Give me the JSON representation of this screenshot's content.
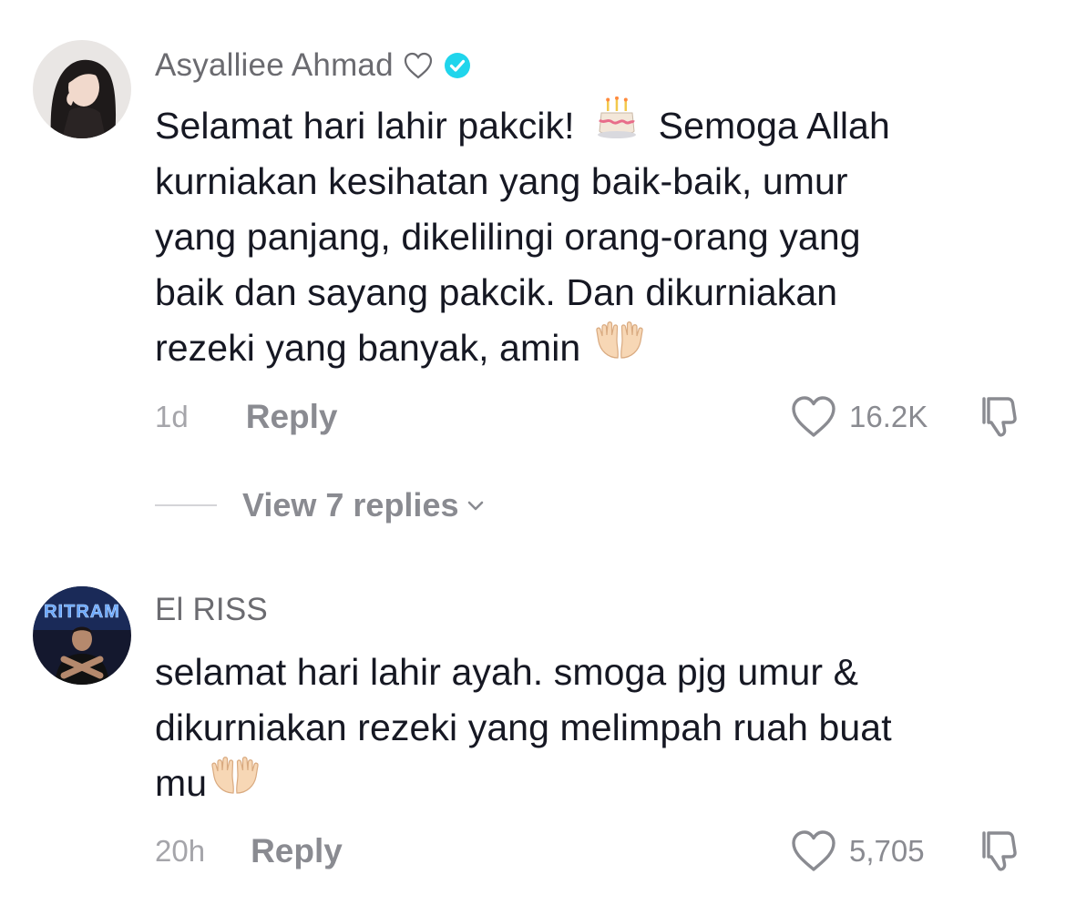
{
  "comments": [
    {
      "username": "Asyalliee Ahmad",
      "lines": [
        "Selamat hari lahir pakcik!",
        "Semoga Allah",
        "kurniakan kesihatan yang baik-baik, umur",
        "yang panjang, dikelilingi orang-orang yang",
        "baik dan sayang pakcik. Dan dikurniakan",
        "rezeki yang banyak, amin"
      ],
      "time": "1d",
      "reply_label": "Reply",
      "likes": "16.2K",
      "view_replies": "View 7 replies"
    },
    {
      "username": "El RISS",
      "avatar_text": "RITRAM",
      "lines": [
        "selamat hari lahir ayah. smoga pjg umur &",
        "dikurniakan rezeki yang melimpah ruah buat",
        "mu"
      ],
      "time": "20h",
      "reply_label": "Reply",
      "likes": "5,705"
    }
  ],
  "colors": {
    "verified": "#20d5ec",
    "muted": "#8a8b91",
    "text": "#161823"
  },
  "icons": [
    "heart-outline-icon",
    "verified-badge-icon",
    "birthday-cake-emoji",
    "raised-hands-emoji",
    "heart-icon",
    "dislike-icon",
    "chevron-down-icon"
  ]
}
